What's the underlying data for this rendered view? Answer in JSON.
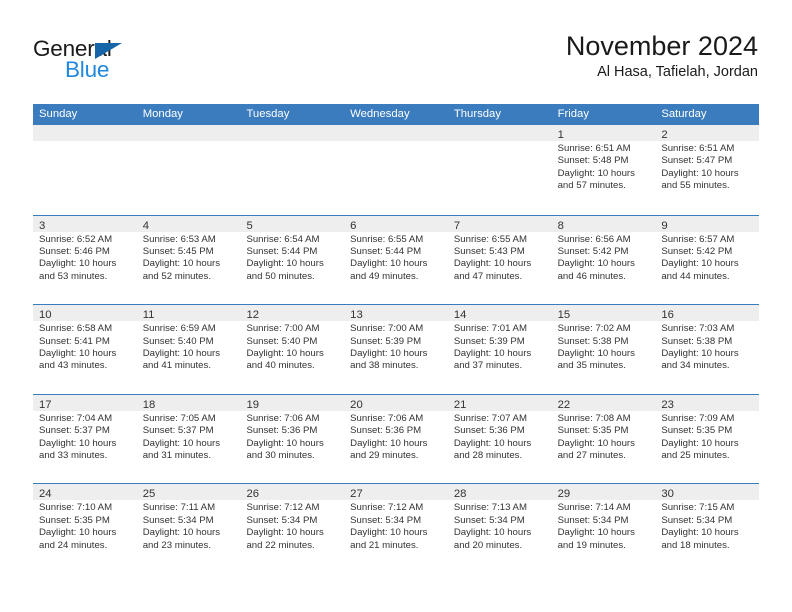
{
  "brand": {
    "logo_line1": "General",
    "logo_line2": "Blue",
    "logo_color_dark": "#1a1a1a",
    "logo_color_blue": "#2288dd",
    "logo_triangle_color": "#1565a8",
    "triangle_icon": "triangle-right-icon"
  },
  "header": {
    "title": "November 2024",
    "subtitle": "Al Hasa, Tafielah, Jordan"
  },
  "theme": {
    "header_bar_color": "#3a7cbe",
    "day_band_color": "#eeeeee",
    "text_color": "#333333",
    "page_background": "#ffffff"
  },
  "weekdays": [
    "Sunday",
    "Monday",
    "Tuesday",
    "Wednesday",
    "Thursday",
    "Friday",
    "Saturday"
  ],
  "weeks": [
    [
      {
        "day": "",
        "lines": []
      },
      {
        "day": "",
        "lines": []
      },
      {
        "day": "",
        "lines": []
      },
      {
        "day": "",
        "lines": []
      },
      {
        "day": "",
        "lines": []
      },
      {
        "day": "1",
        "lines": [
          "Sunrise: 6:51 AM",
          "Sunset: 5:48 PM",
          "Daylight: 10 hours",
          "and 57 minutes."
        ]
      },
      {
        "day": "2",
        "lines": [
          "Sunrise: 6:51 AM",
          "Sunset: 5:47 PM",
          "Daylight: 10 hours",
          "and 55 minutes."
        ]
      }
    ],
    [
      {
        "day": "3",
        "lines": [
          "Sunrise: 6:52 AM",
          "Sunset: 5:46 PM",
          "Daylight: 10 hours",
          "and 53 minutes."
        ]
      },
      {
        "day": "4",
        "lines": [
          "Sunrise: 6:53 AM",
          "Sunset: 5:45 PM",
          "Daylight: 10 hours",
          "and 52 minutes."
        ]
      },
      {
        "day": "5",
        "lines": [
          "Sunrise: 6:54 AM",
          "Sunset: 5:44 PM",
          "Daylight: 10 hours",
          "and 50 minutes."
        ]
      },
      {
        "day": "6",
        "lines": [
          "Sunrise: 6:55 AM",
          "Sunset: 5:44 PM",
          "Daylight: 10 hours",
          "and 49 minutes."
        ]
      },
      {
        "day": "7",
        "lines": [
          "Sunrise: 6:55 AM",
          "Sunset: 5:43 PM",
          "Daylight: 10 hours",
          "and 47 minutes."
        ]
      },
      {
        "day": "8",
        "lines": [
          "Sunrise: 6:56 AM",
          "Sunset: 5:42 PM",
          "Daylight: 10 hours",
          "and 46 minutes."
        ]
      },
      {
        "day": "9",
        "lines": [
          "Sunrise: 6:57 AM",
          "Sunset: 5:42 PM",
          "Daylight: 10 hours",
          "and 44 minutes."
        ]
      }
    ],
    [
      {
        "day": "10",
        "lines": [
          "Sunrise: 6:58 AM",
          "Sunset: 5:41 PM",
          "Daylight: 10 hours",
          "and 43 minutes."
        ]
      },
      {
        "day": "11",
        "lines": [
          "Sunrise: 6:59 AM",
          "Sunset: 5:40 PM",
          "Daylight: 10 hours",
          "and 41 minutes."
        ]
      },
      {
        "day": "12",
        "lines": [
          "Sunrise: 7:00 AM",
          "Sunset: 5:40 PM",
          "Daylight: 10 hours",
          "and 40 minutes."
        ]
      },
      {
        "day": "13",
        "lines": [
          "Sunrise: 7:00 AM",
          "Sunset: 5:39 PM",
          "Daylight: 10 hours",
          "and 38 minutes."
        ]
      },
      {
        "day": "14",
        "lines": [
          "Sunrise: 7:01 AM",
          "Sunset: 5:39 PM",
          "Daylight: 10 hours",
          "and 37 minutes."
        ]
      },
      {
        "day": "15",
        "lines": [
          "Sunrise: 7:02 AM",
          "Sunset: 5:38 PM",
          "Daylight: 10 hours",
          "and 35 minutes."
        ]
      },
      {
        "day": "16",
        "lines": [
          "Sunrise: 7:03 AM",
          "Sunset: 5:38 PM",
          "Daylight: 10 hours",
          "and 34 minutes."
        ]
      }
    ],
    [
      {
        "day": "17",
        "lines": [
          "Sunrise: 7:04 AM",
          "Sunset: 5:37 PM",
          "Daylight: 10 hours",
          "and 33 minutes."
        ]
      },
      {
        "day": "18",
        "lines": [
          "Sunrise: 7:05 AM",
          "Sunset: 5:37 PM",
          "Daylight: 10 hours",
          "and 31 minutes."
        ]
      },
      {
        "day": "19",
        "lines": [
          "Sunrise: 7:06 AM",
          "Sunset: 5:36 PM",
          "Daylight: 10 hours",
          "and 30 minutes."
        ]
      },
      {
        "day": "20",
        "lines": [
          "Sunrise: 7:06 AM",
          "Sunset: 5:36 PM",
          "Daylight: 10 hours",
          "and 29 minutes."
        ]
      },
      {
        "day": "21",
        "lines": [
          "Sunrise: 7:07 AM",
          "Sunset: 5:36 PM",
          "Daylight: 10 hours",
          "and 28 minutes."
        ]
      },
      {
        "day": "22",
        "lines": [
          "Sunrise: 7:08 AM",
          "Sunset: 5:35 PM",
          "Daylight: 10 hours",
          "and 27 minutes."
        ]
      },
      {
        "day": "23",
        "lines": [
          "Sunrise: 7:09 AM",
          "Sunset: 5:35 PM",
          "Daylight: 10 hours",
          "and 25 minutes."
        ]
      }
    ],
    [
      {
        "day": "24",
        "lines": [
          "Sunrise: 7:10 AM",
          "Sunset: 5:35 PM",
          "Daylight: 10 hours",
          "and 24 minutes."
        ]
      },
      {
        "day": "25",
        "lines": [
          "Sunrise: 7:11 AM",
          "Sunset: 5:34 PM",
          "Daylight: 10 hours",
          "and 23 minutes."
        ]
      },
      {
        "day": "26",
        "lines": [
          "Sunrise: 7:12 AM",
          "Sunset: 5:34 PM",
          "Daylight: 10 hours",
          "and 22 minutes."
        ]
      },
      {
        "day": "27",
        "lines": [
          "Sunrise: 7:12 AM",
          "Sunset: 5:34 PM",
          "Daylight: 10 hours",
          "and 21 minutes."
        ]
      },
      {
        "day": "28",
        "lines": [
          "Sunrise: 7:13 AM",
          "Sunset: 5:34 PM",
          "Daylight: 10 hours",
          "and 20 minutes."
        ]
      },
      {
        "day": "29",
        "lines": [
          "Sunrise: 7:14 AM",
          "Sunset: 5:34 PM",
          "Daylight: 10 hours",
          "and 19 minutes."
        ]
      },
      {
        "day": "30",
        "lines": [
          "Sunrise: 7:15 AM",
          "Sunset: 5:34 PM",
          "Daylight: 10 hours",
          "and 18 minutes."
        ]
      }
    ]
  ]
}
